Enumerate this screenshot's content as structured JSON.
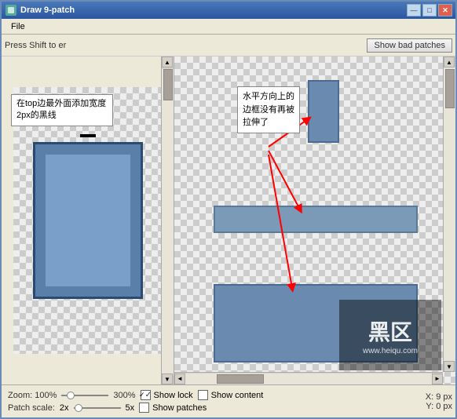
{
  "window": {
    "title": "Draw 9-patch",
    "icon": "patch-icon"
  },
  "titlebar": {
    "minimize_label": "—",
    "maximize_label": "□",
    "close_label": "✕"
  },
  "menu": {
    "items": [
      {
        "label": "File"
      }
    ]
  },
  "toolbar": {
    "hint_text": "Press Shift to er",
    "bad_patches_button": "Show bad patches"
  },
  "annotations": {
    "left": "在top边最外面添加宽度2px的黑线",
    "right": "水平方向上的边框没有再被拉伸了"
  },
  "statusbar": {
    "zoom_label": "Zoom: 100%",
    "zoom_max": "300%",
    "show_lock_label": "Show lock",
    "show_content_label": "Show content",
    "show_patches_label": "Show patches",
    "patch_scale_label": "Patch scale:",
    "patch_scale_value": "2x",
    "patch_scale_max": "5x",
    "x_label": "X:",
    "x_value": "9 px",
    "y_label": "Y:",
    "y_value": "0 px"
  },
  "checkboxes": {
    "show_lock_checked": true,
    "show_content_checked": false,
    "show_patches_checked": false
  }
}
